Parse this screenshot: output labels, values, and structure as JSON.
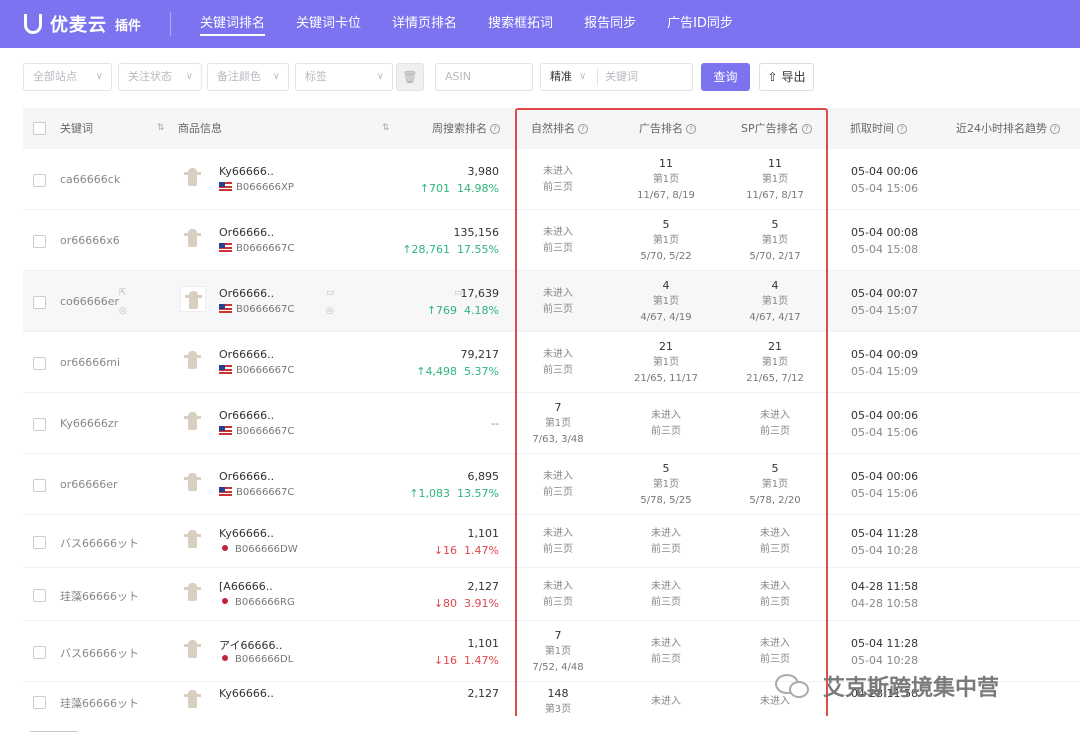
{
  "app": {
    "name": "优麦云",
    "badge": "插件"
  },
  "nav": [
    {
      "label": "关键词排名"
    },
    {
      "label": "关键词卡位"
    },
    {
      "label": "详情页排名"
    },
    {
      "label": "搜索框拓词"
    },
    {
      "label": "报告同步"
    },
    {
      "label": "广告ID同步"
    }
  ],
  "filters": {
    "site": "全部站点",
    "follow": "关注状态",
    "color": "备注颜色",
    "tag": "标签",
    "asin_placeholder": "ASIN",
    "match": "精准",
    "keyword_placeholder": "关键词",
    "query": "查询",
    "export": "导出"
  },
  "columns": {
    "keyword": "关键词",
    "product": "商品信息",
    "weekly": "周搜索排名",
    "natural": "自然排名",
    "ad": "广告排名",
    "sp": "SP广告排名",
    "time": "抓取时间",
    "trend": "近24小时排名趋势"
  },
  "rows": [
    {
      "keyword": "ca66666ck",
      "title": "Ky66666..",
      "asin": "B066666XP",
      "flag": "us",
      "rank": "3,980",
      "change_arrow": "↑",
      "change": "701",
      "pct": "14.98%",
      "dir": "up",
      "natural": [
        "未进入",
        "前三页",
        ""
      ],
      "ad": [
        "11",
        "第1页",
        "11/67, 8/19"
      ],
      "sp": [
        "11",
        "第1页",
        "11/67, 8/17"
      ],
      "t1": "05-04 00:06",
      "t2": "05-04 15:06"
    },
    {
      "keyword": "or66666x6",
      "title": "Or66666..",
      "asin": "B0666667C",
      "flag": "us",
      "rank": "135,156",
      "change_arrow": "↑",
      "change": "28,761",
      "pct": "17.55%",
      "dir": "up",
      "natural": [
        "未进入",
        "前三页",
        ""
      ],
      "ad": [
        "5",
        "第1页",
        "5/70, 5/22"
      ],
      "sp": [
        "5",
        "第1页",
        "5/70, 2/17"
      ],
      "t1": "05-04 00:08",
      "t2": "05-04 15:08"
    },
    {
      "keyword": "co66666er",
      "title": "Or66666..",
      "asin": "B0666667C",
      "flag": "us",
      "rank": "17,639",
      "change_arrow": "↑",
      "change": "769",
      "pct": "4.18%",
      "dir": "up",
      "natural": [
        "未进入",
        "前三页",
        ""
      ],
      "ad": [
        "4",
        "第1页",
        "4/67, 4/19"
      ],
      "sp": [
        "4",
        "第1页",
        "4/67, 4/17"
      ],
      "t1": "05-04 00:07",
      "t2": "05-04 15:07"
    },
    {
      "keyword": "or66666mi",
      "title": "Or66666..",
      "asin": "B0666667C",
      "flag": "us",
      "rank": "79,217",
      "change_arrow": "↑",
      "change": "4,498",
      "pct": "5.37%",
      "dir": "up",
      "natural": [
        "未进入",
        "前三页",
        ""
      ],
      "ad": [
        "21",
        "第1页",
        "21/65, 11/17"
      ],
      "sp": [
        "21",
        "第1页",
        "21/65, 7/12"
      ],
      "t1": "05-04 00:09",
      "t2": "05-04 15:09"
    },
    {
      "keyword": "Ky66666zr",
      "title": "Or66666..",
      "asin": "B0666667C",
      "flag": "us",
      "rank": "--",
      "change_arrow": "",
      "change": "",
      "pct": "",
      "dir": "none",
      "natural": [
        "7",
        "第1页",
        "7/63, 3/48"
      ],
      "ad": [
        "未进入",
        "前三页",
        ""
      ],
      "sp": [
        "未进入",
        "前三页",
        ""
      ],
      "t1": "05-04 00:06",
      "t2": "05-04 15:06"
    },
    {
      "keyword": "or66666er",
      "title": "Or66666..",
      "asin": "B0666667C",
      "flag": "us",
      "rank": "6,895",
      "change_arrow": "↑",
      "change": "1,083",
      "pct": "13.57%",
      "dir": "up",
      "natural": [
        "未进入",
        "前三页",
        ""
      ],
      "ad": [
        "5",
        "第1页",
        "5/78, 5/25"
      ],
      "sp": [
        "5",
        "第1页",
        "5/78, 2/20"
      ],
      "t1": "05-04 00:06",
      "t2": "05-04 15:06"
    },
    {
      "keyword": "バス66666ット",
      "title": "Ky66666..",
      "asin": "B066666DW",
      "flag": "jp",
      "rank": "1,101",
      "change_arrow": "↓",
      "change": "16",
      "pct": "1.47%",
      "dir": "down",
      "natural": [
        "未进入",
        "前三页",
        ""
      ],
      "ad": [
        "未进入",
        "前三页",
        ""
      ],
      "sp": [
        "未进入",
        "前三页",
        ""
      ],
      "t1": "05-04 11:28",
      "t2": "05-04 10:28"
    },
    {
      "keyword": "珪藻66666ット",
      "title": "[A66666..",
      "asin": "B066666RG",
      "flag": "jp",
      "rank": "2,127",
      "change_arrow": "↓",
      "change": "80",
      "pct": "3.91%",
      "dir": "down",
      "natural": [
        "未进入",
        "前三页",
        ""
      ],
      "ad": [
        "未进入",
        "前三页",
        ""
      ],
      "sp": [
        "未进入",
        "前三页",
        ""
      ],
      "t1": "04-28 11:58",
      "t2": "04-28 10:58"
    },
    {
      "keyword": "バス66666ット",
      "title": "アイ66666..",
      "asin": "B066666DL",
      "flag": "jp",
      "rank": "1,101",
      "change_arrow": "↓",
      "change": "16",
      "pct": "1.47%",
      "dir": "down",
      "natural": [
        "7",
        "第1页",
        "7/52, 4/48"
      ],
      "ad": [
        "未进入",
        "前三页",
        ""
      ],
      "sp": [
        "未进入",
        "前三页",
        ""
      ],
      "t1": "05-04 11:28",
      "t2": "05-04 10:28"
    },
    {
      "keyword": "珪藻66666ット",
      "title": "Ky66666..",
      "asin": "",
      "flag": "",
      "rank": "2,127",
      "change_arrow": "",
      "change": "",
      "pct": "",
      "dir": "none",
      "natural": [
        "148",
        "第3页",
        ""
      ],
      "ad": [
        "未进入",
        "",
        ""
      ],
      "sp": [
        "未进入",
        "",
        ""
      ],
      "t1": "04-28 11:58",
      "t2": ""
    }
  ],
  "watermark": "艾克斯跨境集中营"
}
